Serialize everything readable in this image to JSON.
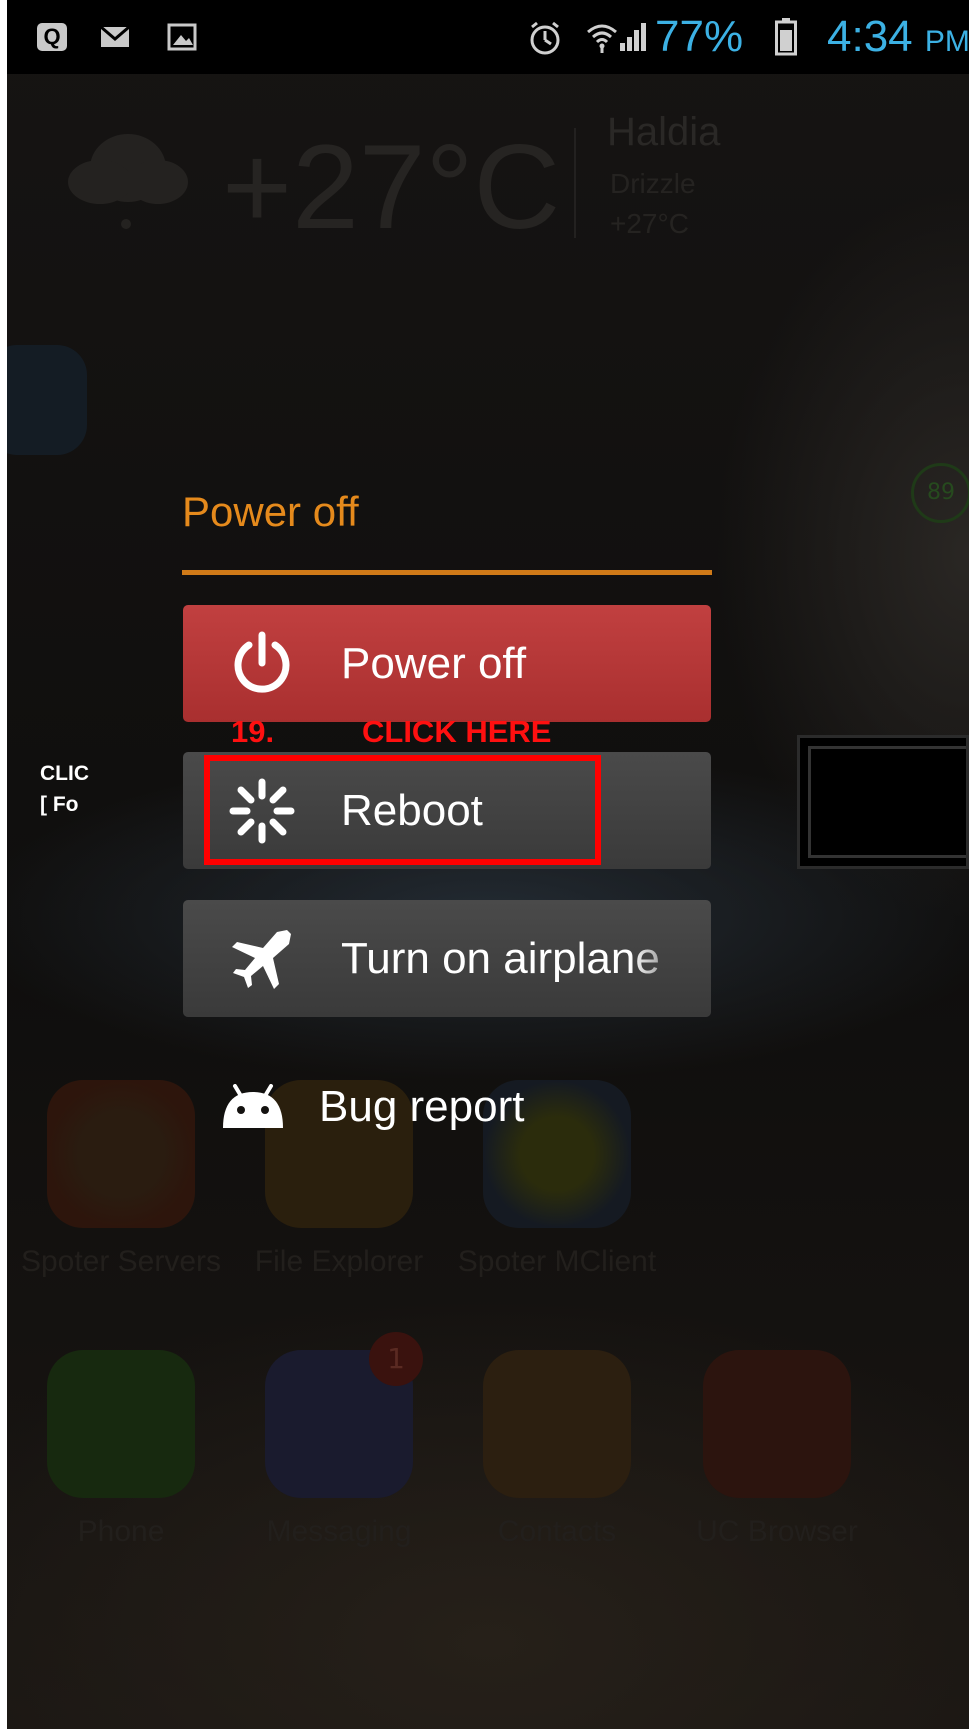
{
  "status_bar": {
    "icons_left": [
      "quick-q-icon",
      "mail-icon",
      "image-icon"
    ],
    "icons_right": [
      "alarm-icon",
      "wifi-icon",
      "signal-icon",
      "battery-icon"
    ],
    "battery_percent": "77%",
    "time": "4:34",
    "ampm": "PM",
    "accent_color": "#3cb1e4"
  },
  "weather": {
    "temperature": "+27°C",
    "city": "Haldia",
    "condition": "Drizzle",
    "temp_small": "+27°C",
    "icon": "cloud-icon"
  },
  "home_badge": "89",
  "apps_row1": [
    {
      "label": "Spoter Servers",
      "icon": "car-icon"
    },
    {
      "label": "File Explorer",
      "icon": "folder-icon"
    },
    {
      "label": "Spoter MClient",
      "icon": "person-icon"
    }
  ],
  "dock": [
    {
      "label": "Phone",
      "icon": "phone-icon"
    },
    {
      "label": "Messaging",
      "icon": "message-icon",
      "badge": "1"
    },
    {
      "label": "Contacts",
      "icon": "contact-icon"
    },
    {
      "label": "UC Browser",
      "icon": "uc-browser-icon"
    }
  ],
  "power_dialog": {
    "title": "Power off",
    "title_color": "#e58a1c",
    "options": [
      {
        "label": "Power off",
        "icon": "power-icon"
      },
      {
        "label": "Reboot",
        "icon": "reboot-spinner-icon"
      },
      {
        "label": "Turn on airplane",
        "icon": "airplane-icon"
      },
      {
        "label": "Bug report",
        "icon": "android-bug-icon"
      }
    ]
  },
  "annotation": {
    "step": "19.",
    "instruction": "CLICK HERE",
    "highlight_color": "#ff0000",
    "callout_line1": "CLIC",
    "callout_line2": "[ Fo"
  }
}
